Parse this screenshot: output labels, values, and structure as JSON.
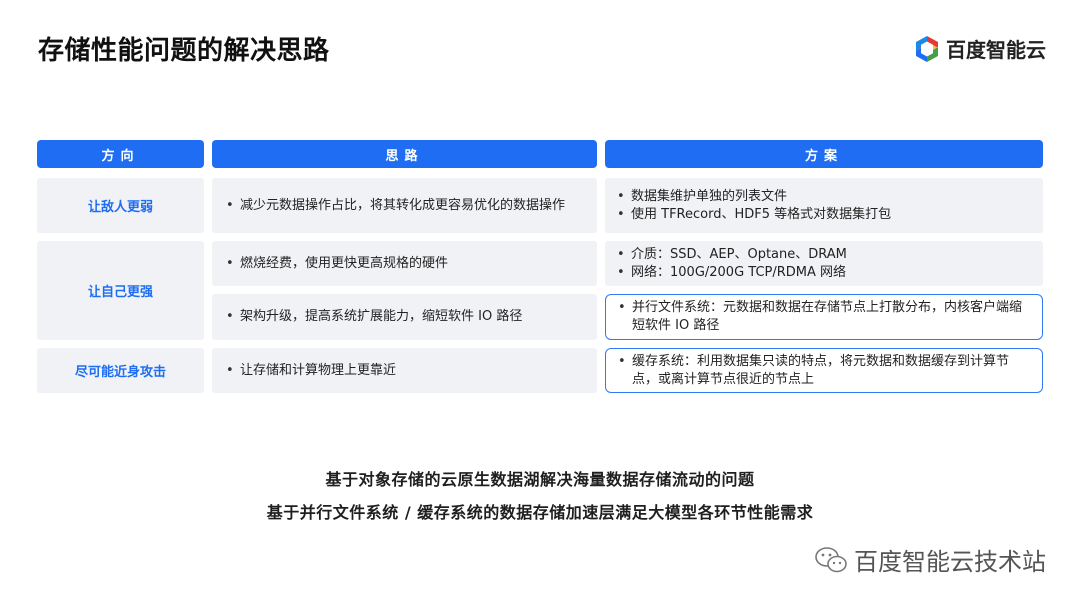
{
  "title": "存储性能问题的解决思路",
  "logo": {
    "text": "百度智能云",
    "icon": "baidu-cloud-hexagon-icon"
  },
  "table": {
    "headers": [
      "方向",
      "思路",
      "方案"
    ],
    "directions": [
      "让敌人更弱",
      "让自己更强",
      "尽可能近身攻击"
    ],
    "ideas": [
      "减少元数据操作占比，将其转化成更容易优化的数据操作",
      "燃烧经费，使用更快更高规格的硬件",
      "架构升级，提高系统扩展能力，缩短软件 IO 路径",
      "让存储和计算物理上更靠近"
    ],
    "solutions": [
      [
        "数据集维护单独的列表文件",
        "使用 TFRecord、HDF5 等格式对数据集打包"
      ],
      [
        "介质：SSD、AEP、Optane、DRAM",
        "网络：100G/200G TCP/RDMA 网络"
      ],
      [
        "并行文件系统：元数据和数据在存储节点上打散分布，内核客户端缩短软件 IO 路径"
      ],
      [
        "缓存系统：利用数据集只读的特点，将元数据和数据缓存到计算节点，或离计算节点很近的节点上"
      ]
    ]
  },
  "summary": [
    "基于对象存储的云原生数据湖解决海量数据存储流动的问题",
    "基于并行文件系统 / 缓存系统的数据存储加速层满足大模型各环节性能需求"
  ],
  "watermark": {
    "text": "百度智能云技术站",
    "icon": "wechat-icon"
  },
  "colors": {
    "accent": "#1e6df2",
    "cell_bg": "#f1f2f5"
  }
}
